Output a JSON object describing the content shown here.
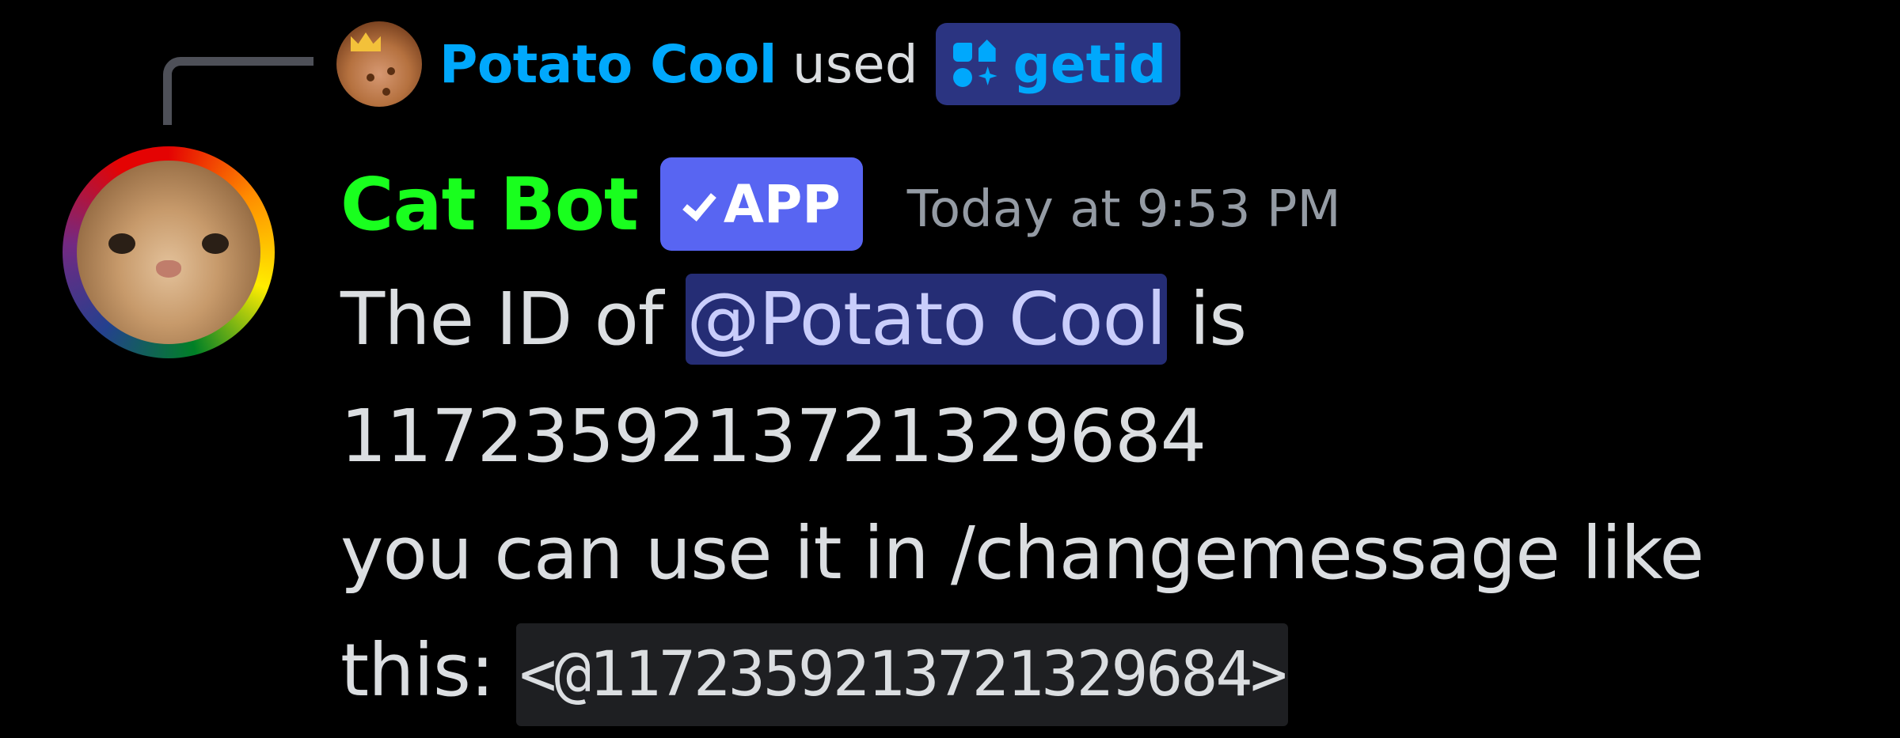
{
  "reply": {
    "username": "Potato Cool",
    "action_text": "used",
    "command_name": "getid",
    "command_icon": "slash-command-icon"
  },
  "message": {
    "author": "Cat Bot",
    "app_badge": "APP",
    "badge_icon": "check-icon",
    "timestamp": "Today at 9:53 PM",
    "line1_prefix": "The ID of ",
    "mention": "@Potato Cool",
    "line1_suffix": " is",
    "user_id": "1172359213721329684",
    "line3": "you can use it in /changemessage like",
    "line4_prefix": "this: ",
    "code": "<@1172359213721329684>"
  },
  "colors": {
    "background": "#000000",
    "reply_username": "#00a8fc",
    "bot_name": "#19ff1e",
    "app_badge": "#5865f2",
    "mention_bg": "#252d75",
    "timestamp": "#949ba4"
  }
}
